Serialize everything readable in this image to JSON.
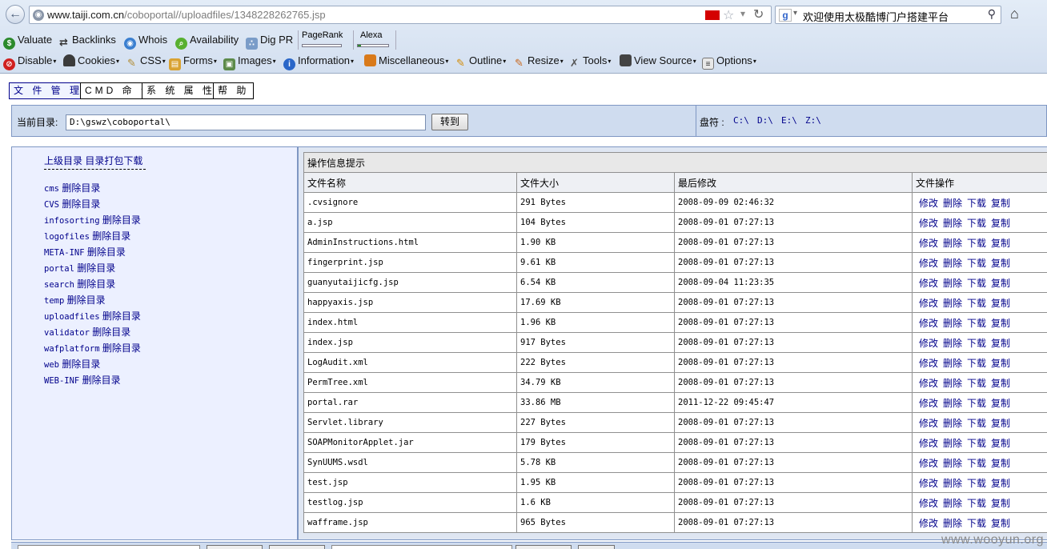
{
  "browser": {
    "url_host": "www.taiji.com.cn",
    "url_path": "/coboportal//uploadfiles/1348228262765.jsp",
    "search_text": "欢迎使用太极酷博门户搭建平台"
  },
  "toolbar_seo": [
    "Valuate",
    "Backlinks",
    "Whois",
    "Availability",
    "Dig PR"
  ],
  "meters": {
    "pagerank": {
      "label": "PageRank",
      "level": 0
    },
    "alexa": {
      "label": "Alexa",
      "level": 0.1
    }
  },
  "toolbar_webdev": [
    "Disable",
    "Cookies",
    "CSS",
    "Forms",
    "Images",
    "Information",
    "Miscellaneous",
    "Outline",
    "Resize",
    "Tools",
    "View Source",
    "Options"
  ],
  "menu": [
    "文 件 管 理",
    "CMD 命 令",
    "系 统 属 性",
    "帮 助"
  ],
  "dirbar": {
    "label": "当前目录:",
    "path": "D:\\gswz\\coboportal\\",
    "go_label": "转到",
    "drive_label": "盘符 :",
    "drives": [
      "C:\\",
      "D:\\",
      "E:\\",
      "Z:\\"
    ]
  },
  "left": {
    "parent_link": "上级目录",
    "pack_link": "目录打包下载",
    "delete_label": "删除目录",
    "dirs": [
      "cms",
      "CVS",
      "infosorting",
      "logofiles",
      "META-INF",
      "portal",
      "search",
      "temp",
      "uploadfiles",
      "validator",
      "wafplatform",
      "web",
      "WEB-INF"
    ]
  },
  "table": {
    "caption": "操作信息提示",
    "headers": [
      "文件名称",
      "文件大小",
      "最后修改",
      "文件操作"
    ],
    "ops": [
      "修改",
      "删除",
      "下载",
      "复制"
    ],
    "rows": [
      [
        ".cvsignore",
        "291 Bytes",
        "2008-09-09 02:46:32"
      ],
      [
        "a.jsp",
        "104 Bytes",
        "2008-09-01 07:27:13"
      ],
      [
        "AdminInstructions.html",
        "1.90 KB",
        "2008-09-01 07:27:13"
      ],
      [
        "fingerprint.jsp",
        "9.61 KB",
        "2008-09-01 07:27:13"
      ],
      [
        "guanyutaijicfg.jsp",
        "6.54 KB",
        "2008-09-04 11:23:35"
      ],
      [
        "happyaxis.jsp",
        "17.69 KB",
        "2008-09-01 07:27:13"
      ],
      [
        "index.html",
        "1.96 KB",
        "2008-09-01 07:27:13"
      ],
      [
        "index.jsp",
        "917 Bytes",
        "2008-09-01 07:27:13"
      ],
      [
        "LogAudit.xml",
        "222 Bytes",
        "2008-09-01 07:27:13"
      ],
      [
        "PermTree.xml",
        "34.79 KB",
        "2008-09-01 07:27:13"
      ],
      [
        "portal.rar",
        "33.86 MB",
        "2011-12-22 09:45:47"
      ],
      [
        "Servlet.library",
        "227 Bytes",
        "2008-09-01 07:27:13"
      ],
      [
        "SOAPMonitorApplet.jar",
        "179 Bytes",
        "2008-09-01 07:27:13"
      ],
      [
        "SynUUMS.wsdl",
        "5.78 KB",
        "2008-09-01 07:27:13"
      ],
      [
        "test.jsp",
        "1.95 KB",
        "2008-09-01 07:27:13"
      ],
      [
        "testlog.jsp",
        "1.6 KB",
        "2008-09-01 07:27:13"
      ],
      [
        "wafframe.jsp",
        "965 Bytes",
        "2008-09-01 07:27:13"
      ]
    ]
  },
  "watermark": "www.wooyun.org"
}
